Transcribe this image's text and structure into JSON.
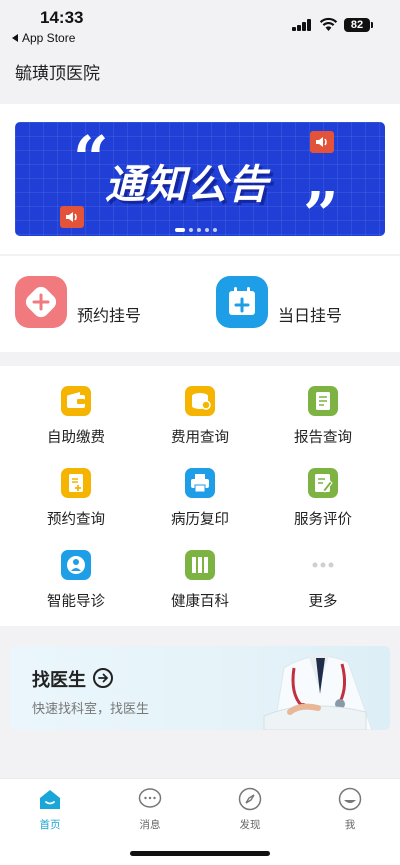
{
  "status_bar": {
    "time": "14:33",
    "back_app": "App Store",
    "battery": "82"
  },
  "header": {
    "hospital_name": "毓璜顶医院"
  },
  "banner": {
    "text": "通知公告",
    "slides": 5,
    "active_slide": 0,
    "background_color": "#1f3fd6"
  },
  "registration": [
    {
      "label": "预约挂号",
      "icon": "plus-icon",
      "color": "#f07a7e"
    },
    {
      "label": "当日挂号",
      "icon": "calendar-plus-icon",
      "color": "#1e9ee6"
    }
  ],
  "services": [
    {
      "label": "自助缴费",
      "icon": "wallet-icon",
      "color": "#f4b400"
    },
    {
      "label": "费用查询",
      "icon": "coins-icon",
      "color": "#f4b400"
    },
    {
      "label": "报告查询",
      "icon": "report-icon",
      "color": "#7cb342"
    },
    {
      "label": "预约查询",
      "icon": "document-plus-icon",
      "color": "#f4b400"
    },
    {
      "label": "病历复印",
      "icon": "printer-icon",
      "color": "#1e9ee6"
    },
    {
      "label": "服务评价",
      "icon": "edit-note-icon",
      "color": "#7cb342"
    },
    {
      "label": "智能导诊",
      "icon": "guide-person-icon",
      "color": "#1e9ee6"
    },
    {
      "label": "健康百科",
      "icon": "books-icon",
      "color": "#7cb342"
    },
    {
      "label": "更多",
      "icon": "more-dots-icon",
      "color": "#cfcfcf"
    }
  ],
  "find_doctor": {
    "title": "找医生",
    "subtitle": "快速找科室，找医生"
  },
  "tab_bar": {
    "tabs": [
      {
        "label": "首页",
        "icon": "home-icon",
        "active": true
      },
      {
        "label": "消息",
        "icon": "message-icon",
        "active": false
      },
      {
        "label": "发现",
        "icon": "compass-icon",
        "active": false
      },
      {
        "label": "我",
        "icon": "profile-icon",
        "active": false
      }
    ],
    "active_color": "#1aa6d8"
  }
}
